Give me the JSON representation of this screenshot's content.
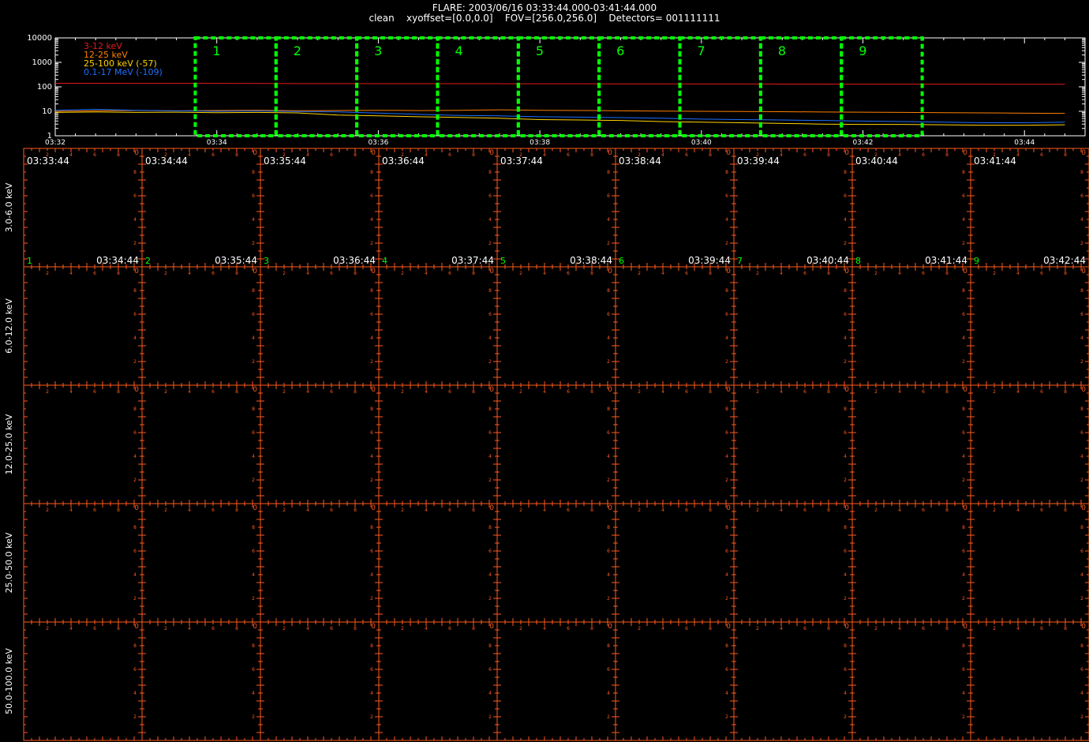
{
  "header": {
    "line1": "FLARE: 2003/06/16 03:33:44.000-03:41:44.000",
    "line2": "clean    xyoffset=[0.0,0.0]    FOV=[256.0,256.0]    Detectors= 001111111"
  },
  "colors": {
    "background": "#000000",
    "grid": "#ff5a1e",
    "interval_box": "#00ff00",
    "band1": "#e41a1c",
    "band2": "#ff7f00",
    "band3": "#ffd400",
    "band4": "#1f6fff",
    "text": "#ffffff"
  },
  "chart_data": [
    {
      "type": "line",
      "title": "",
      "xlabel": "",
      "ylabel": "",
      "yscale": "log",
      "xlim": [
        "03:32:00",
        "03:44:45"
      ],
      "ylim": [
        1,
        10000
      ],
      "yticks": [
        "10000",
        "1000",
        "100",
        "10",
        "1"
      ],
      "xticks": [
        "03:32",
        "03:34",
        "03:36",
        "03:38",
        "03:40",
        "03:42",
        "03:44"
      ],
      "legend_placement": "top-left",
      "x_minutes": [
        0,
        0.5,
        1,
        1.5,
        2,
        2.5,
        3,
        3.5,
        4,
        4.5,
        5,
        5.5,
        6,
        6.5,
        7,
        7.5,
        8,
        8.5,
        9,
        9.5,
        10,
        10.5,
        11,
        11.5,
        12,
        12.5
      ],
      "series": [
        {
          "name": "3-12 keV",
          "color": "#e41a1c",
          "values": [
            140,
            140,
            139,
            138,
            138,
            137,
            136,
            136,
            135,
            135,
            134,
            134,
            133,
            133,
            132,
            132,
            131,
            131,
            130,
            130,
            129,
            129,
            128,
            128,
            127,
            127
          ]
        },
        {
          "name": "12-25 keV",
          "color": "#ff7f00",
          "values": [
            10,
            10.5,
            10.8,
            10.5,
            10.8,
            11,
            10.6,
            10.8,
            11,
            10.7,
            11,
            11.5,
            11,
            10.8,
            10.5,
            10.2,
            10,
            9.8,
            9.6,
            9.4,
            9.2,
            9,
            8.8,
            8.6,
            8.4,
            8.2
          ]
        },
        {
          "name": "25-100 keV (-57)",
          "color": "#ffd400",
          "values": [
            9,
            9.4,
            9,
            9.2,
            8.8,
            9,
            8.6,
            7,
            6.5,
            6,
            5.6,
            5.2,
            4.6,
            4.4,
            4.2,
            3.8,
            3.6,
            3.4,
            3.2,
            3,
            2.9,
            2.9,
            2.8,
            2.7,
            2.7,
            2.8
          ]
        },
        {
          "name": "0.1-17 MeV (-109)",
          "color": "#1f6fff",
          "values": [
            11,
            12,
            11,
            10.5,
            10,
            10.3,
            9.8,
            9.5,
            8.5,
            7.5,
            6.8,
            6.5,
            6,
            5.8,
            5.5,
            5.2,
            4.8,
            4.6,
            4.4,
            4.2,
            4,
            3.8,
            3.6,
            3.4,
            3.4,
            3.6
          ]
        }
      ],
      "intervals": [
        {
          "label": "1",
          "start": "03:33:44",
          "end": "03:34:44"
        },
        {
          "label": "2",
          "start": "03:34:44",
          "end": "03:35:44"
        },
        {
          "label": "3",
          "start": "03:35:44",
          "end": "03:36:44"
        },
        {
          "label": "4",
          "start": "03:36:44",
          "end": "03:37:44"
        },
        {
          "label": "5",
          "start": "03:37:44",
          "end": "03:38:44"
        },
        {
          "label": "6",
          "start": "03:38:44",
          "end": "03:39:44"
        },
        {
          "label": "7",
          "start": "03:39:44",
          "end": "03:40:44"
        },
        {
          "label": "8",
          "start": "03:40:44",
          "end": "03:41:44"
        },
        {
          "label": "9",
          "start": "03:41:44",
          "end": "03:42:44"
        }
      ]
    },
    {
      "type": "table",
      "title": "",
      "energy_bands": [
        "3.0-6.0 keV",
        "6.0-12.0 keV",
        "12.0-25.0 keV",
        "25.0-50.0 keV",
        "50.0-100.0 keV"
      ],
      "columns": [
        {
          "num": "1",
          "start": "03:33:44",
          "end": "03:34:44"
        },
        {
          "num": "2",
          "start": "03:34:44",
          "end": "03:35:44"
        },
        {
          "num": "3",
          "start": "03:35:44",
          "end": "03:36:44"
        },
        {
          "num": "4",
          "start": "03:36:44",
          "end": "03:37:44"
        },
        {
          "num": "5",
          "start": "03:37:44",
          "end": "03:38:44"
        },
        {
          "num": "6",
          "start": "03:38:44",
          "end": "03:39:44"
        },
        {
          "num": "7",
          "start": "03:39:44",
          "end": "03:40:44"
        },
        {
          "num": "8",
          "start": "03:40:44",
          "end": "03:41:44"
        },
        {
          "num": "9",
          "start": "03:41:44",
          "end": "03:42:44"
        }
      ],
      "cell_tick_labels": [
        "2",
        "4",
        "6",
        "8"
      ],
      "cell_corner_label": "0"
    }
  ]
}
